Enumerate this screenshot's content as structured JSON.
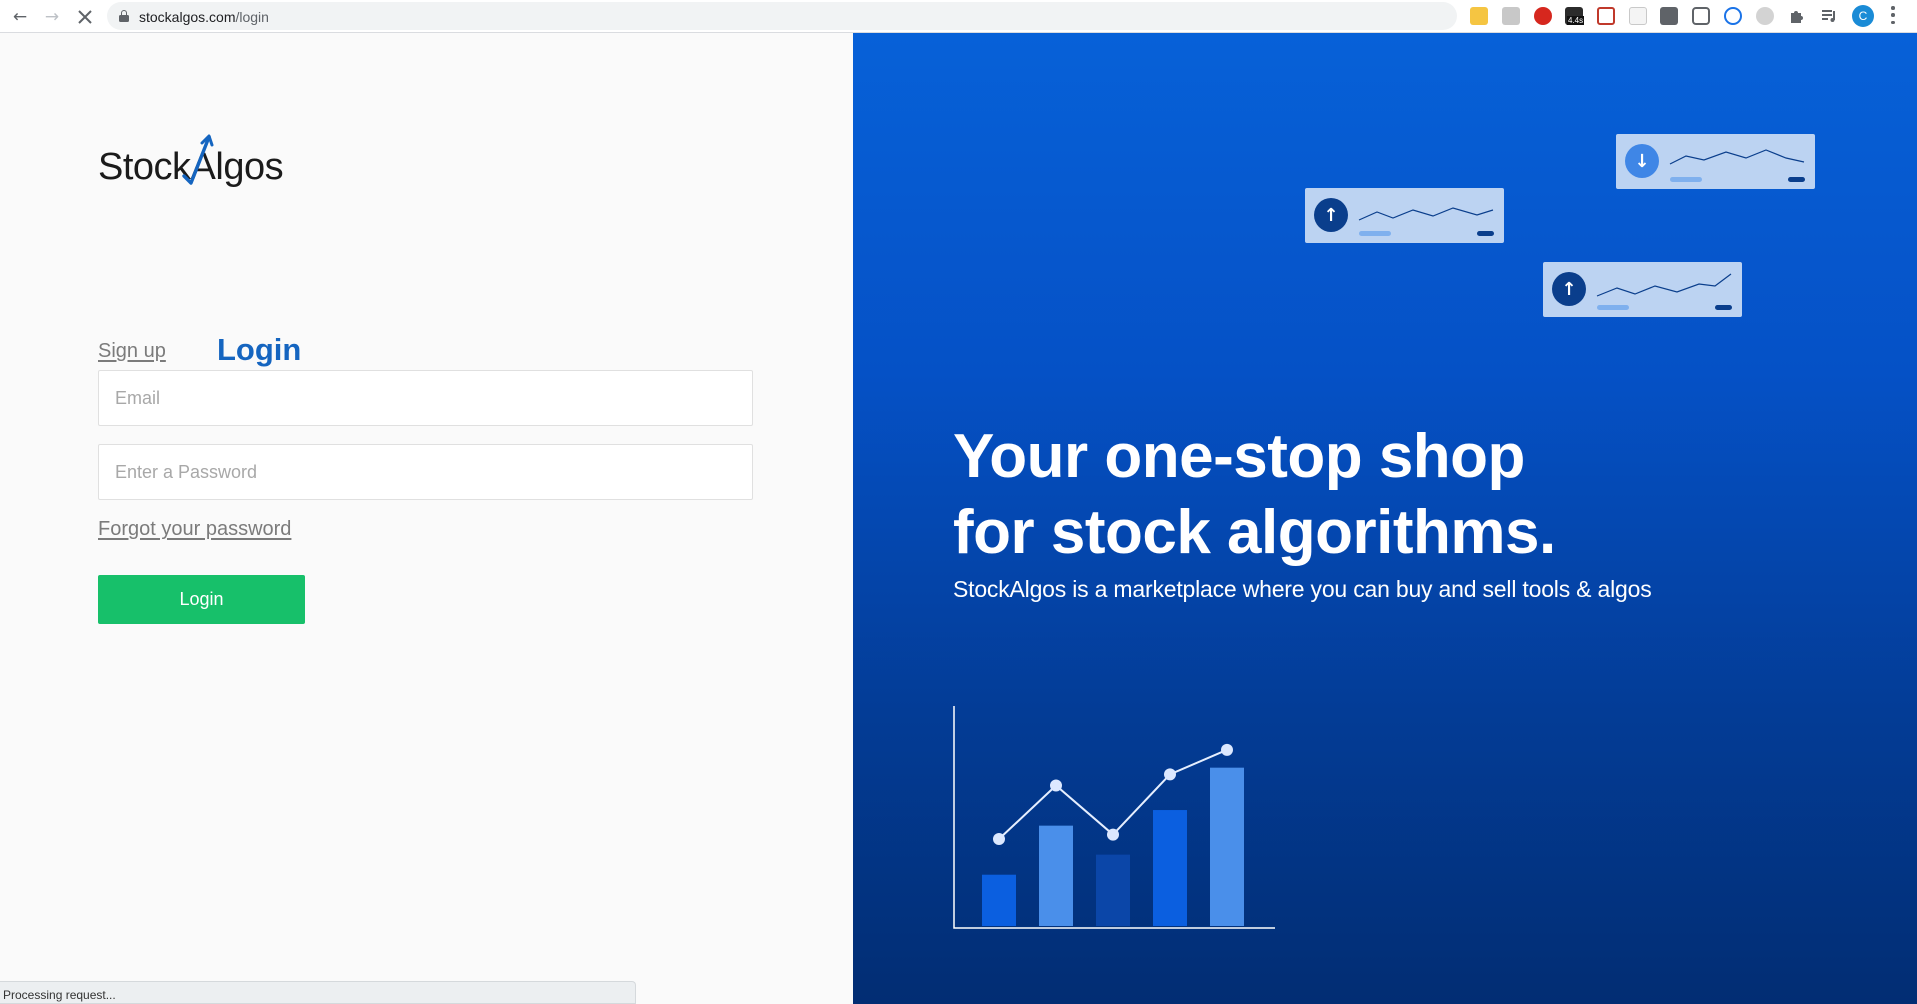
{
  "browser": {
    "url_host": "stockalgos.com",
    "url_path": "/login",
    "extension_badge": "4.4s",
    "profile_initial": "C"
  },
  "brand": {
    "logo_part1": "Stock",
    "logo_part2": "Algos",
    "logo_accent_color": "#1565c0"
  },
  "auth": {
    "tab_signup": "Sign up",
    "tab_login": "Login",
    "active_tab": "Login",
    "email_placeholder": "Email",
    "password_placeholder": "Enter a Password",
    "forgot_password": "Forgot your password",
    "login_button": "Login",
    "button_color": "#17c06a"
  },
  "status_bar": {
    "text": "Processing request..."
  },
  "hero": {
    "headline_line1": "Your one-stop shop",
    "headline_line2": "for stock algorithms.",
    "subheadline": "StockAlgos is a marketplace where you can buy and sell tools & algos",
    "background_colors": [
      "#0761d8",
      "#022d73"
    ],
    "cards": [
      {
        "icon": "arrow-up-icon"
      },
      {
        "icon": "arrow-down-icon"
      },
      {
        "icon": "arrow-up-icon"
      }
    ],
    "illustration": {
      "bars": [
        0.23,
        0.45,
        0.32,
        0.52,
        0.71
      ],
      "line_points": [
        0.39,
        0.63,
        0.41,
        0.68,
        0.79
      ]
    }
  }
}
